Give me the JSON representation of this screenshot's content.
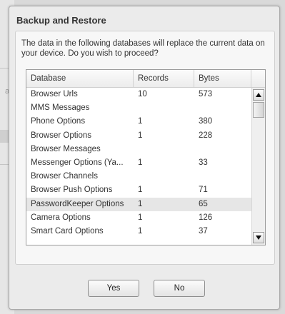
{
  "dialog": {
    "title": "Backup and Restore",
    "message": "The data in the following databases will replace the current data on your device. Do you wish to proceed?"
  },
  "table": {
    "columns": [
      "Database",
      "Records",
      "Bytes"
    ],
    "rows": [
      {
        "database": "Browser Urls",
        "records": "10",
        "bytes": "573"
      },
      {
        "database": "MMS Messages",
        "records": "",
        "bytes": ""
      },
      {
        "database": "Phone Options",
        "records": "1",
        "bytes": "380"
      },
      {
        "database": "Browser Options",
        "records": "1",
        "bytes": "228"
      },
      {
        "database": "Browser Messages",
        "records": "",
        "bytes": ""
      },
      {
        "database": "Messenger Options (Ya...",
        "records": "1",
        "bytes": "33"
      },
      {
        "database": "Browser Channels",
        "records": "",
        "bytes": ""
      },
      {
        "database": "Browser Push Options",
        "records": "1",
        "bytes": "71"
      },
      {
        "database": "PasswordKeeper Options",
        "records": "1",
        "bytes": "65"
      },
      {
        "database": "Camera Options",
        "records": "1",
        "bytes": "126"
      },
      {
        "database": "Smart Card Options",
        "records": "1",
        "bytes": "37"
      }
    ],
    "selected_row_index": 8
  },
  "buttons": {
    "yes_label": "Yes",
    "no_label": "No"
  },
  "icons": {
    "scroll_up": "chevron-up-icon",
    "scroll_down": "chevron-down-icon"
  },
  "background": {
    "partial_text": "a"
  }
}
